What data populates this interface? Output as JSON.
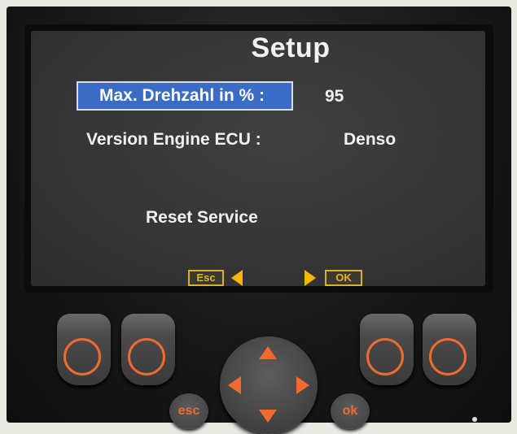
{
  "screen": {
    "title": "Setup",
    "rows": [
      {
        "label": "Max. Drehzahl in % :",
        "value": "95",
        "selected": true
      },
      {
        "label": "Version  Engine ECU :",
        "value": "Denso",
        "selected": false
      },
      {
        "label": "Reset Service",
        "value": "",
        "selected": false
      }
    ],
    "softkeys": {
      "left": "Esc",
      "right": "OK"
    }
  },
  "keypad": {
    "esc_label": "esc",
    "ok_label": "ok",
    "function_keys": [
      "f1",
      "f2",
      "f3",
      "f4"
    ],
    "dpad": [
      "arrow-up",
      "arrow-down",
      "arrow-left",
      "arrow-right"
    ]
  },
  "colors": {
    "selection": "#3a6bc5",
    "softkey": "#e8b520",
    "key_accent": "#f26a2e",
    "screen_bg": "#383938"
  }
}
